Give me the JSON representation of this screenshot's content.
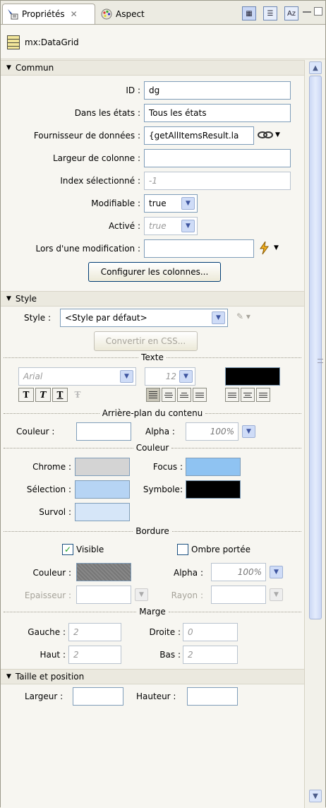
{
  "tabs": [
    {
      "label": "Propriétés",
      "icon": "properties-icon",
      "active": true,
      "close": "✕"
    },
    {
      "label": "Aspect",
      "icon": "palette-icon",
      "active": false
    }
  ],
  "toolbar": {
    "category_view_icon": "category-view-icon",
    "list_view_icon": "list-view-icon",
    "alpha_sort_icon": "alpha-sort-icon"
  },
  "component": {
    "name": "mx:DataGrid"
  },
  "commun": {
    "title": "Commun",
    "id_label": "ID :",
    "id_value": "dg",
    "states_label": "Dans les états :",
    "states_value": "Tous les états",
    "provider_label": "Fournisseur de données :",
    "provider_value": "{getAllItemsResult.la",
    "colwidth_label": "Largeur de colonne :",
    "colwidth_value": "",
    "selindex_label": "Index sélectionné :",
    "selindex_value": "-1",
    "editable_label": "Modifiable :",
    "editable_value": "true",
    "enabled_label": "Activé :",
    "enabled_value": "true",
    "onchange_label": "Lors d'une modification :",
    "onchange_value": "",
    "configure_button": "Configurer les colonnes..."
  },
  "style": {
    "title": "Style",
    "style_label": "Style :",
    "style_value": "<Style par défaut>",
    "convert_button": "Convertir en CSS...",
    "text_header": "Texte",
    "font_value": "Arial",
    "size_value": "12",
    "text_color": "#000000",
    "bg_header": "Arrière-plan du contenu",
    "bg_color_label": "Couleur :",
    "bg_alpha_label": "Alpha :",
    "bg_alpha_value": "100%",
    "color_header": "Couleur",
    "chrome_label": "Chrome :",
    "chrome_color": "#d4d4d4",
    "focus_label": "Focus :",
    "focus_color": "#8fc3f2",
    "selection_label": "Sélection :",
    "selection_color": "#b6d4f4",
    "symbol_label": "Symbole:",
    "symbol_color": "#000000",
    "hover_label": "Survol :",
    "hover_color": "#d6e6f8",
    "border_header": "Bordure",
    "visible_label": "Visible",
    "visible_checked": true,
    "shadow_label": "Ombre portée",
    "shadow_checked": false,
    "border_color_label": "Couleur :",
    "border_color": "#7a7a7a",
    "border_alpha_label": "Alpha :",
    "border_alpha_value": "100%",
    "thickness_label": "Epaisseur :",
    "radius_label": "Rayon :",
    "margin_header": "Marge",
    "left_label": "Gauche :",
    "left_value": "2",
    "right_label": "Droite :",
    "right_value": "0",
    "top_label": "Haut :",
    "top_value": "2",
    "bottom_label": "Bas :",
    "bottom_value": "2"
  },
  "size": {
    "title": "Taille et position",
    "width_label": "Largeur :",
    "width_value": "",
    "height_label": "Hauteur :",
    "height_value": ""
  }
}
